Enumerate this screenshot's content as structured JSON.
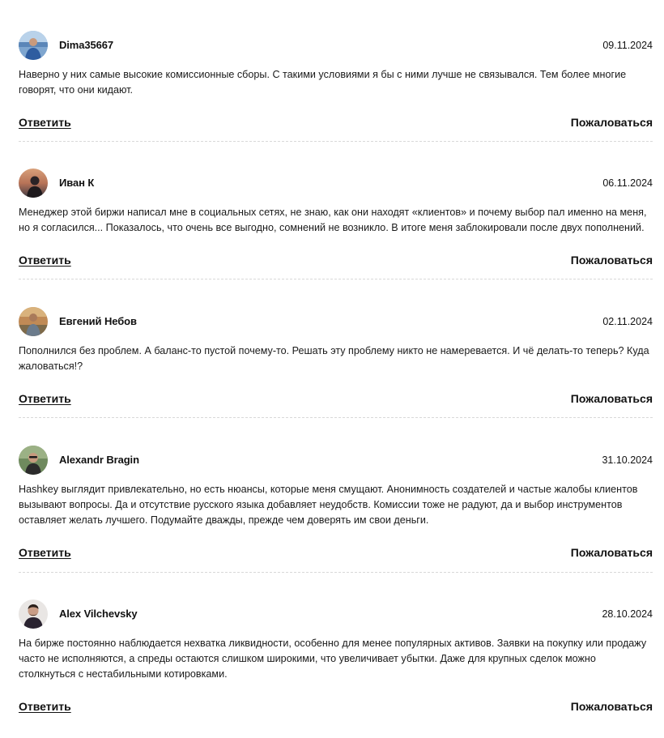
{
  "comments": [
    {
      "author": "Dima35667",
      "date": "09.11.2024",
      "text": "Наверно у них самые высокие комиссионные сборы. С такими условиями я бы с ними лучше не связывался. Тем более многие говорят, что они кидают.",
      "reply_label": "Ответить",
      "report_label": "Пожаловаться"
    },
    {
      "author": "Иван К",
      "date": "06.11.2024",
      "text": "Менеджер этой биржи написал мне в социальных сетях, не знаю, как они находят «клиентов» и почему выбор пал именно на меня, но я согласился... Показалось, что очень все выгодно, сомнений не возникло. В итоге меня заблокировали после двух пополнений.",
      "reply_label": "Ответить",
      "report_label": "Пожаловаться"
    },
    {
      "author": "Евгений Небов",
      "date": "02.11.2024",
      "text": "Пополнился без проблем. А баланс-то пустой почему-то. Решать эту проблему никто не намеревается. И чё делать-то теперь? Куда жаловаться!?",
      "reply_label": "Ответить",
      "report_label": "Пожаловаться"
    },
    {
      "author": "Alexandr Bragin",
      "date": "31.10.2024",
      "text": "Hashkey выглядит привлекательно, но есть нюансы, которые меня смущают. Анонимность создателей и частые жалобы клиентов вызывают вопросы. Да и отсутствие русского языка добавляет неудобств. Комиссии тоже не радуют, да и выбор инструментов оставляет желать лучшего. Подумайте дважды, прежде чем доверять им свои деньги.",
      "reply_label": "Ответить",
      "report_label": "Пожаловаться"
    },
    {
      "author": "Alex Vilchevsky",
      "date": "28.10.2024",
      "text": "На бирже постоянно наблюдается нехватка ликвидности, особенно для менее популярных активов. Заявки на покупку или продажу часто не исполняются, а спреды остаются слишком широкими, что увеличивает убытки. Даже для крупных сделок можно столкнуться с нестабильными котировками.",
      "reply_label": "Ответить",
      "report_label": "Пожаловаться"
    }
  ]
}
